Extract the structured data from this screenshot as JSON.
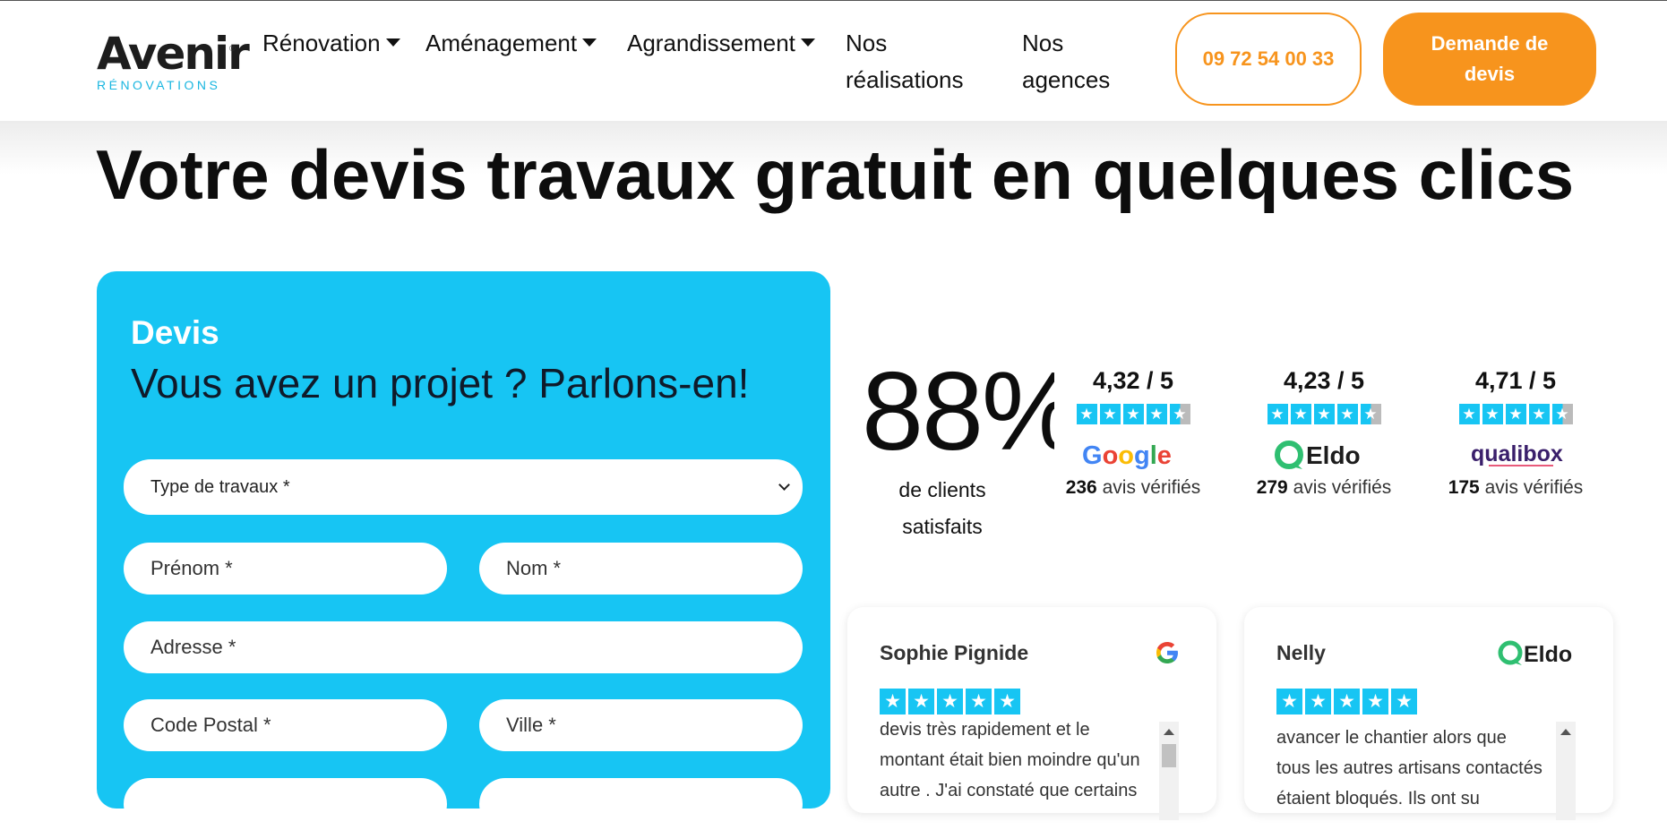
{
  "header": {
    "logo_word": "Avenir",
    "logo_registered": "®",
    "logo_sub": "RÉNOVATIONS",
    "nav": [
      {
        "label": "Rénovation",
        "dropdown": true
      },
      {
        "label": "Aménagement",
        "dropdown": true
      },
      {
        "label": "Agrandissement",
        "dropdown": true
      },
      {
        "label_line1": "Nos",
        "label_line2": "réalisations"
      },
      {
        "label_line1": "Nos",
        "label_line2": "agences"
      }
    ],
    "phone": "09 72 54 00 33",
    "cta": "Demande de devis"
  },
  "page_title": "Votre devis travaux gratuit en quelques clics",
  "form": {
    "eyebrow": "Devis",
    "title": "Vous avez un projet ? Parlons-en!",
    "type_select": "Type de travaux *",
    "firstname_placeholder": "Prénom *",
    "lastname_placeholder": "Nom *",
    "address_placeholder": "Adresse *",
    "postal_placeholder": "Code Postal *",
    "city_placeholder": "Ville *"
  },
  "stats": {
    "percent": "88%",
    "line1": "de clients",
    "line2": "satisfaits"
  },
  "ratings": [
    {
      "score": "4,32 / 5",
      "stars": 4.3,
      "brand": "Google",
      "count": "236",
      "count_label": "avis vérifiés"
    },
    {
      "score": "4,23 / 5",
      "stars": 4.2,
      "brand": "Eldo",
      "count": "279",
      "count_label": "avis vérifiés"
    },
    {
      "score": "4,71 / 5",
      "stars": 4.7,
      "brand": "qualibox",
      "count": "175",
      "count_label": "avis vérifiés"
    }
  ],
  "reviews": [
    {
      "name": "Sophie Pignide",
      "source": "Google",
      "stars": 5,
      "text": "devis très rapidement et le montant était bien moindre qu'un autre . J'ai constaté que certains"
    },
    {
      "name": "Nelly",
      "source": "Eldo",
      "stars": 5,
      "text": "avancer le chantier alors que tous les autres artisans contactés étaient bloqués. Ils ont su"
    }
  ],
  "colors": {
    "accent_orange": "#f7941d",
    "accent_blue": "#17c5f3",
    "logo_blue": "#19b6e0",
    "eldo_green": "#2fbf71",
    "qualibox_purple": "#3a1f6b"
  }
}
